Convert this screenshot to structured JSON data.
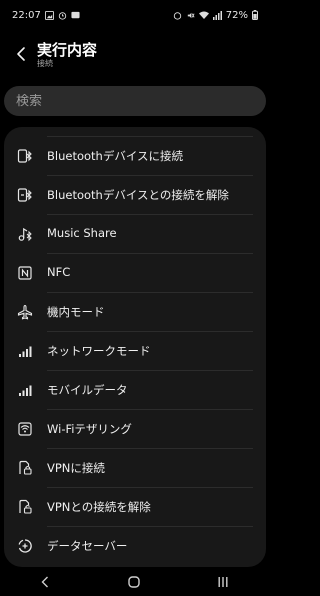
{
  "status_bar": {
    "time": "22:07",
    "battery": "72%"
  },
  "header": {
    "title": "実行内容",
    "subtitle": "接続"
  },
  "search": {
    "placeholder": "検索"
  },
  "items": [
    {
      "label": "Bluetoothデバイスに接続",
      "icon": "bluetooth-connect-icon"
    },
    {
      "label": "Bluetoothデバイスとの接続を解除",
      "icon": "bluetooth-disconnect-icon"
    },
    {
      "label": "Music Share",
      "icon": "music-share-icon"
    },
    {
      "label": "NFC",
      "icon": "nfc-icon"
    },
    {
      "label": "機内モード",
      "icon": "airplane-icon"
    },
    {
      "label": "ネットワークモード",
      "icon": "signal-bars-icon"
    },
    {
      "label": "モバイルデータ",
      "icon": "signal-bars-icon"
    },
    {
      "label": "Wi-Fiテザリング",
      "icon": "hotspot-icon"
    },
    {
      "label": "VPNに接続",
      "icon": "vpn-connect-icon"
    },
    {
      "label": "VPNとの接続を解除",
      "icon": "vpn-disconnect-icon"
    },
    {
      "label": "データセーバー",
      "icon": "data-saver-icon"
    }
  ],
  "colors": {
    "background": "#000000",
    "card": "#181818",
    "search_bg": "#2b2b2b",
    "text": "#f0f0f0"
  }
}
